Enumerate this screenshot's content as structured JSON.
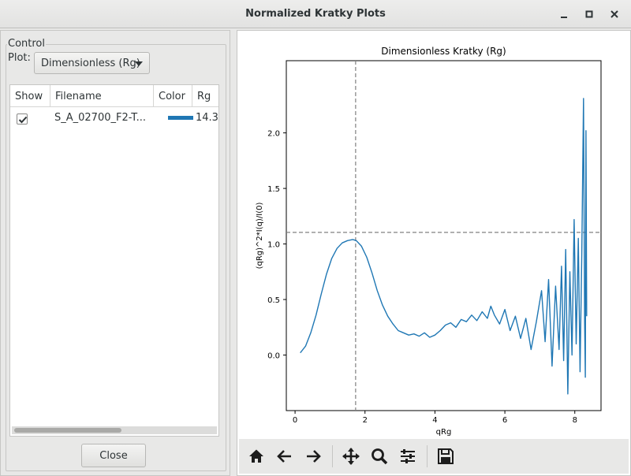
{
  "window": {
    "title": "Normalized Kratky Plots"
  },
  "control": {
    "group_title": "Control",
    "plot_label": "Plot:",
    "plot_select_value": "Dimensionless (Rg)"
  },
  "table": {
    "columns": [
      "Show",
      "Filename",
      "Color",
      "Rg"
    ],
    "rows": [
      {
        "show": true,
        "filename": "S_A_02700_F2-T...",
        "color": "#1f77b4",
        "rg": "14.3"
      }
    ]
  },
  "close_label": "Close",
  "icons": [
    "home-icon",
    "back-arrow-icon",
    "forward-arrow-icon",
    "pan-icon",
    "zoom-icon",
    "configure-subplots-icon",
    "save-icon"
  ],
  "chart_data": {
    "type": "line",
    "title": "Dimensionless Kratky (Rg)",
    "xlabel": "qRg",
    "ylabel": "(qRg)^2*I(q)/I(0)",
    "xlim": [
      -0.25,
      8.75
    ],
    "ylim": [
      -0.5,
      2.65
    ],
    "xticks": [
      0,
      2,
      4,
      6,
      8
    ],
    "yticks": [
      0.0,
      0.5,
      1.0,
      1.5,
      2.0
    ],
    "xtick_labels": [
      "0",
      "2",
      "4",
      "6",
      "8"
    ],
    "ytick_labels": [
      "0.0",
      "0.5",
      "1.0",
      "1.5",
      "2.0"
    ],
    "series_color": "#1f77b4",
    "reference_lines": {
      "vertical_x": 1.732,
      "horizontal_y": 1.104
    },
    "series": [
      {
        "x": [
          0.15,
          0.3,
          0.45,
          0.6,
          0.75,
          0.9,
          1.05,
          1.2,
          1.35,
          1.5,
          1.65,
          1.75,
          1.9,
          2.05,
          2.2,
          2.35,
          2.5,
          2.65,
          2.8,
          2.95,
          3.1,
          3.25,
          3.4,
          3.55,
          3.7,
          3.85,
          4.0,
          4.15,
          4.3,
          4.45,
          4.6,
          4.75,
          4.9,
          5.05,
          5.2,
          5.35,
          5.5,
          5.6,
          5.7,
          5.85,
          6.0,
          6.15,
          6.3,
          6.45,
          6.6,
          6.75,
          6.9,
          7.05,
          7.15,
          7.25,
          7.35,
          7.45,
          7.55,
          7.62,
          7.68,
          7.74,
          7.8,
          7.86,
          7.92,
          7.98,
          8.04,
          8.1,
          8.15,
          8.2,
          8.25,
          8.28,
          8.3,
          8.32,
          8.34
        ],
        "y": [
          0.02,
          0.08,
          0.2,
          0.36,
          0.55,
          0.73,
          0.87,
          0.96,
          1.01,
          1.03,
          1.04,
          1.03,
          0.98,
          0.88,
          0.74,
          0.58,
          0.45,
          0.35,
          0.28,
          0.22,
          0.2,
          0.18,
          0.19,
          0.17,
          0.2,
          0.16,
          0.18,
          0.22,
          0.27,
          0.29,
          0.25,
          0.32,
          0.3,
          0.36,
          0.31,
          0.39,
          0.33,
          0.44,
          0.36,
          0.28,
          0.41,
          0.22,
          0.35,
          0.15,
          0.33,
          0.05,
          0.3,
          0.58,
          0.12,
          0.68,
          -0.1,
          0.62,
          0.05,
          0.8,
          -0.05,
          0.95,
          -0.35,
          0.75,
          0.0,
          1.22,
          0.1,
          1.05,
          -0.15,
          0.9,
          2.31,
          0.3,
          -0.2,
          2.02,
          0.35
        ]
      }
    ]
  }
}
